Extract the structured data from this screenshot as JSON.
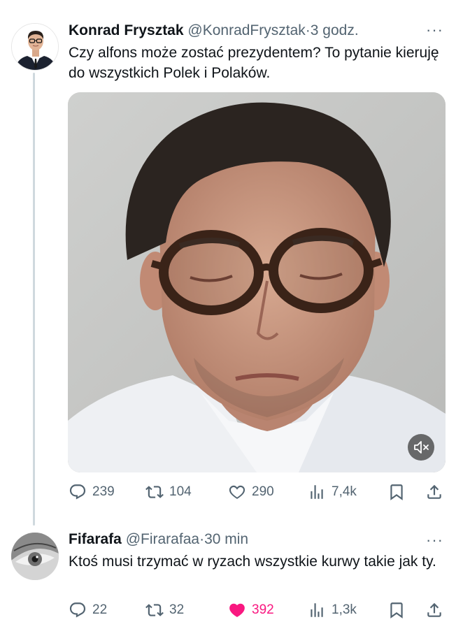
{
  "tweet": {
    "author_name": "Konrad Frysztak",
    "author_handle": "@KonradFrysztak",
    "separator": "·",
    "time": "3 godz.",
    "more": "···",
    "text": "Czy alfons może zostać prezydentem? To pytanie kieruję do wszystkich Polek i Polaków.",
    "media": {
      "type": "video",
      "muted": true
    },
    "replies": "239",
    "reposts": "104",
    "likes": "290",
    "views": "7,4k"
  },
  "reply": {
    "author_name": "Fifarafa",
    "author_handle": "@Firarafaa",
    "separator": "·",
    "time": "30 min",
    "more": "···",
    "text": "Ktoś musi trzymać w ryzach wszystkie kurwy takie jak ty.",
    "replies": "22",
    "reposts": "32",
    "likes": "392",
    "liked": true,
    "views": "1,3k"
  },
  "colors": {
    "text_primary": "#0f1419",
    "text_secondary": "#536471",
    "like_active": "#f91880",
    "thread_line": "#cfd9de"
  },
  "icons": [
    "reply-icon",
    "repost-icon",
    "like-icon",
    "views-icon",
    "bookmark-icon",
    "share-icon",
    "mute-icon",
    "more-icon"
  ]
}
